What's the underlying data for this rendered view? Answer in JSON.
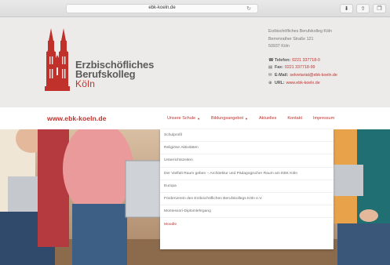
{
  "browser": {
    "url": "ebk-koeln.de",
    "reload_icon": "reload-icon"
  },
  "header": {
    "logo": {
      "line1": "Erzbischöfliches",
      "line2": "Berufskolleg",
      "line3": "Köln"
    },
    "contact": {
      "name": "Erzbischöfliches Berufskolleg Köln",
      "street": "Berrenrather Straße 121",
      "city": "50937 Köln",
      "phone_label": "Telefon:",
      "phone": "0221 337718-0",
      "fax_label": "Fax:",
      "fax": "0221 337718-99",
      "email_label": "E-Mail:",
      "email": "sekretariat@ebk-koeln.de",
      "web_label": "URL:",
      "web": "www.ebk-koeln.de"
    }
  },
  "nav": {
    "site_url": "www.ebk-koeln.de",
    "items": [
      {
        "label": "Unsere Schule",
        "has_caret": true
      },
      {
        "label": "Bildungsangebot",
        "has_caret": true
      },
      {
        "label": "Aktuelles",
        "has_caret": false
      },
      {
        "label": "Kontakt",
        "has_caret": false
      },
      {
        "label": "Impressum",
        "has_caret": false
      }
    ]
  },
  "dropdown": {
    "items": [
      "Schulprofil",
      "Religiöse Aktivitäten",
      "Unterrichtszeiten",
      "Der Vielfalt Raum geben – Architektur und Pädagogischer Raum am EBK Köln",
      "Europa",
      "Förderverein des Erzbischöflichen Berufskollegs Köln e.V.",
      "Montessori-Diplomlehrgang",
      "Moodle"
    ],
    "active_index": 7
  },
  "colors": {
    "brand_red": "#c0312b",
    "header_bg": "#ecebea"
  }
}
